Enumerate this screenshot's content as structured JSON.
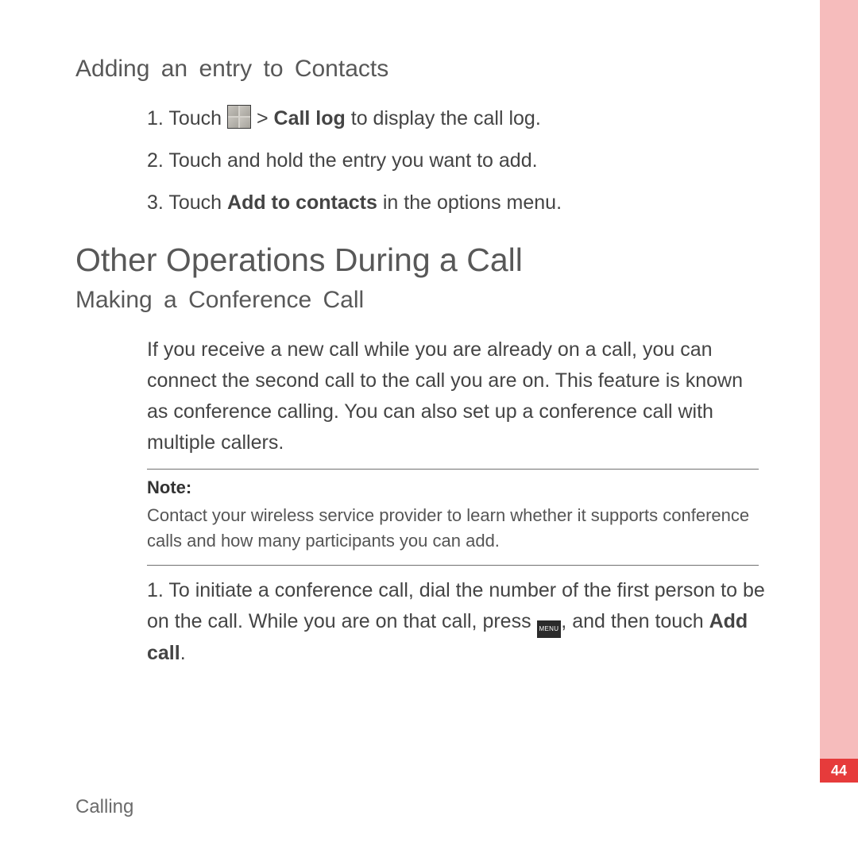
{
  "section1": {
    "heading": "Adding an entry to Contacts",
    "steps": {
      "s1_prefix": "1. Touch ",
      "s1_gt": " > ",
      "s1_bold": "Call log",
      "s1_suffix": " to display the call log.",
      "s2": "2. Touch and hold the entry you want to add.",
      "s3_prefix": "3. Touch ",
      "s3_bold": "Add to contacts",
      "s3_suffix": " in the options menu."
    }
  },
  "main_heading": "Other Operations During a Call",
  "section2": {
    "heading": "Making a Conference Call",
    "para": "If you receive a new call while you are already on a call, you can connect the second call to the call you are on. This feature is known as conference calling. You can also set up a conference call with multiple callers.",
    "note_label": "Note:",
    "note_text": "Contact your wireless service provider to learn whether it supports conference calls and how many participants you can add.",
    "steps": {
      "s1_a": "1. To initiate a conference call, dial the number of the first person to be on the call. While you are on that call, press ",
      "s1_b": ", and then touch ",
      "s1_bold": "Add call",
      "s1_c": "."
    }
  },
  "footer": {
    "chapter": "Calling",
    "page": "44"
  },
  "icons": {
    "menu_label": "MENU"
  }
}
